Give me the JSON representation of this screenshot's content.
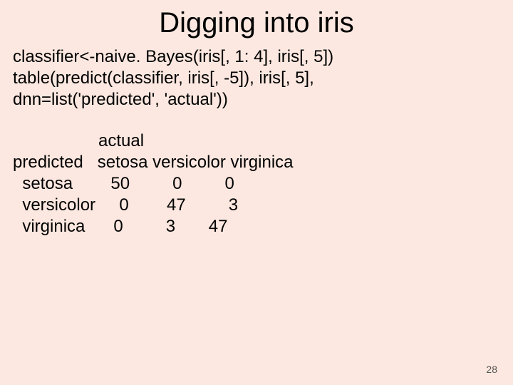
{
  "title": "Digging into iris",
  "code": {
    "line1": "classifier<-naive. Bayes(iris[, 1: 4], iris[, 5])",
    "line2": "table(predict(classifier, iris[, -5]), iris[, 5],",
    "line3": "dnn=list('predicted', 'actual'))"
  },
  "output": {
    "line1": "                  actual",
    "line2": "predicted   setosa versicolor virginica",
    "line3": "  setosa        50         0         0",
    "line4": "  versicolor     0        47         3",
    "line5": "  virginica      0         3       47"
  },
  "pagenum": "28",
  "chart_data": {
    "type": "table",
    "title": "Confusion matrix (predicted vs actual)",
    "row_label": "predicted",
    "col_label": "actual",
    "rows": [
      "setosa",
      "versicolor",
      "virginica"
    ],
    "columns": [
      "setosa",
      "versicolor",
      "virginica"
    ],
    "values": [
      [
        50,
        0,
        0
      ],
      [
        0,
        47,
        3
      ],
      [
        0,
        3,
        47
      ]
    ]
  }
}
